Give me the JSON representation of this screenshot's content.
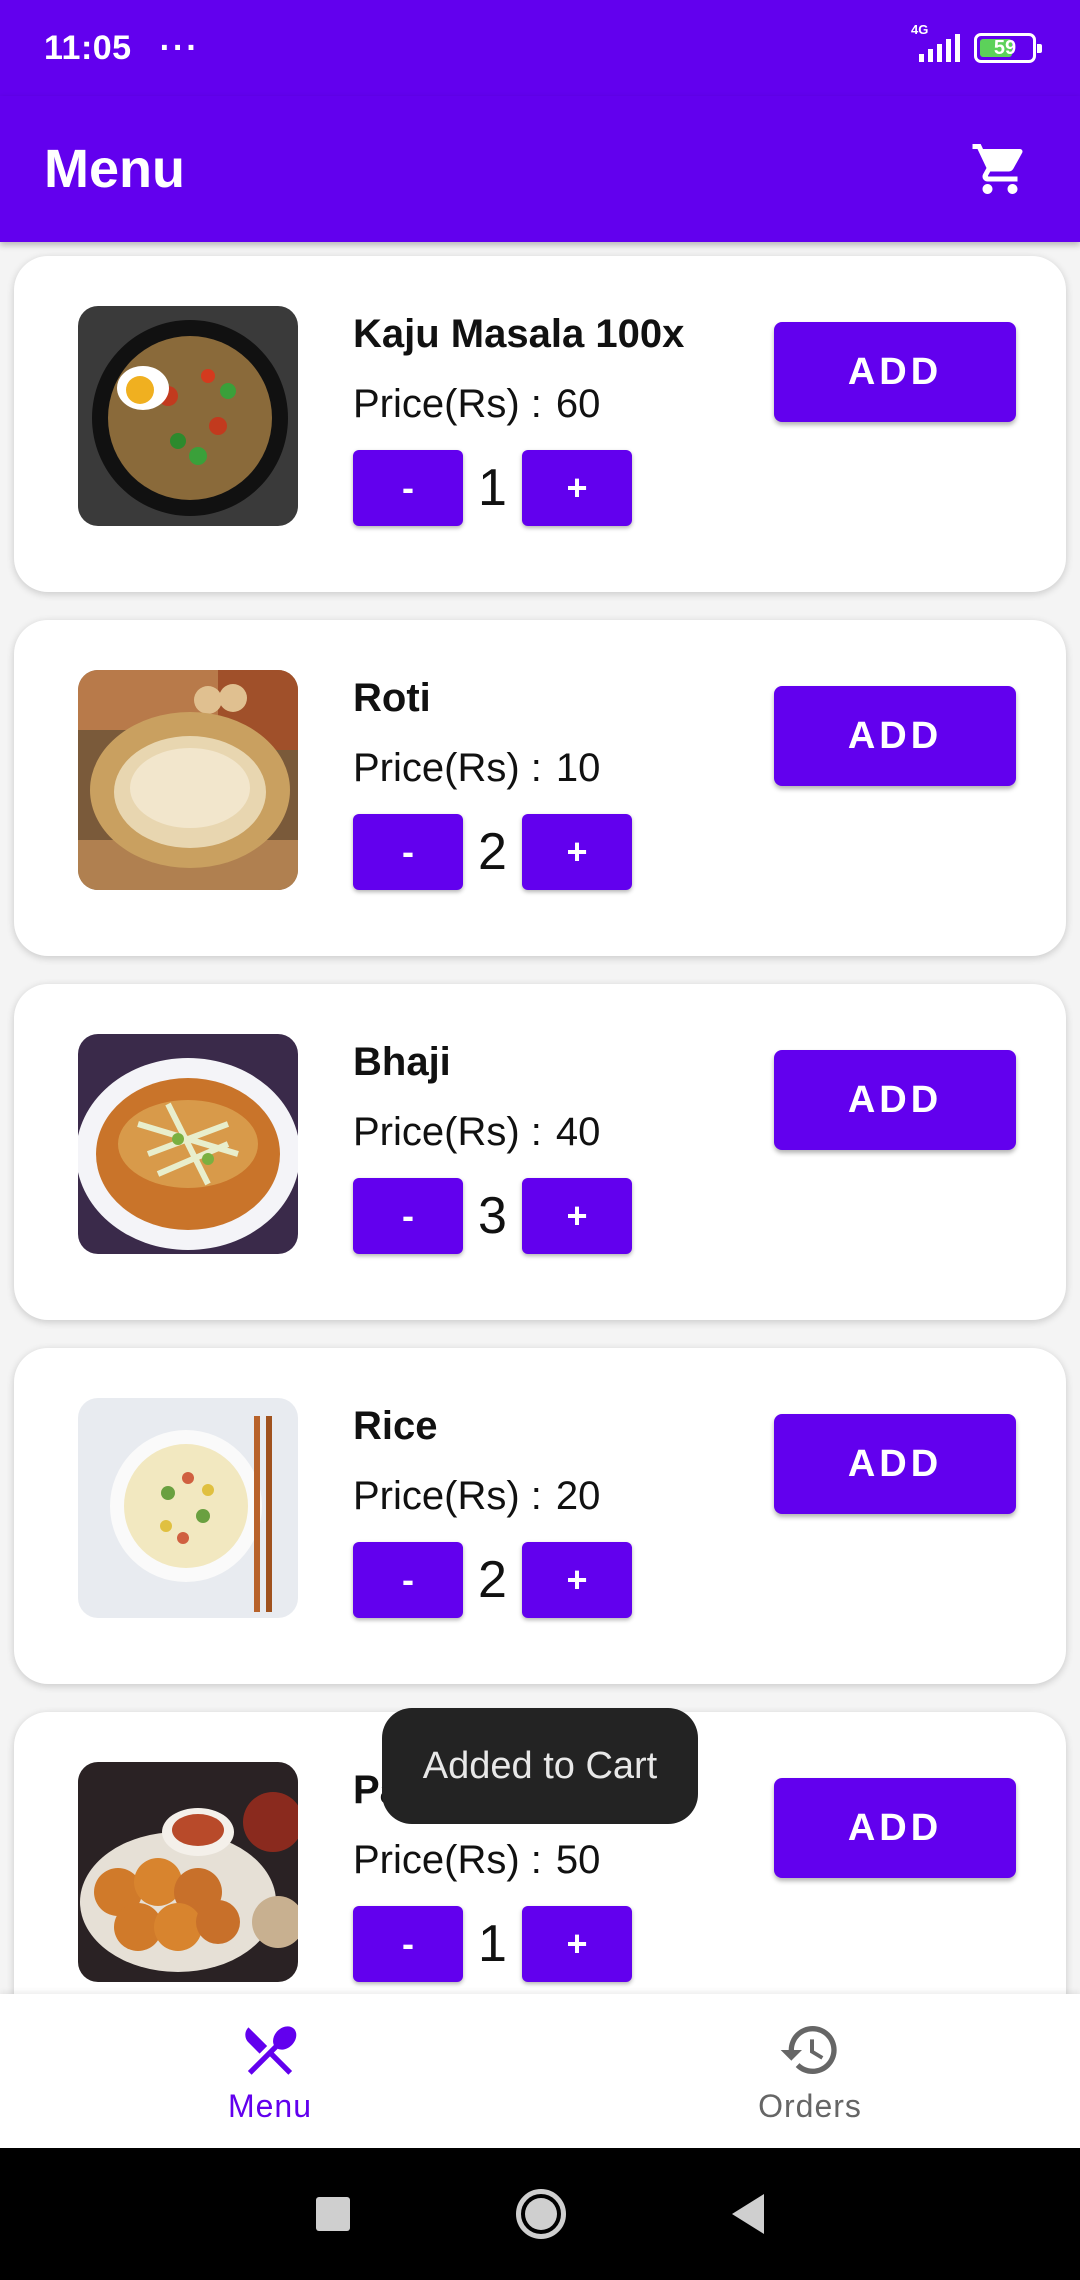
{
  "status_bar": {
    "time": "11:05",
    "more": "···",
    "network": "4G",
    "battery": "59"
  },
  "app_bar": {
    "title": "Menu",
    "cart_icon": "cart-icon"
  },
  "items": [
    {
      "name": "Kaju Masala 100x",
      "price_label": "Price(Rs) :",
      "price": "60",
      "qty": "1",
      "minus": "-",
      "plus": "+",
      "add": "ADD"
    },
    {
      "name": "Roti",
      "price_label": "Price(Rs) :",
      "price": "10",
      "qty": "2",
      "minus": "-",
      "plus": "+",
      "add": "ADD"
    },
    {
      "name": "Bhaji",
      "price_label": "Price(Rs) :",
      "price": "40",
      "qty": "3",
      "minus": "-",
      "plus": "+",
      "add": "ADD"
    },
    {
      "name": "Rice",
      "price_label": "Price(Rs) :",
      "price": "20",
      "qty": "2",
      "minus": "-",
      "plus": "+",
      "add": "ADD"
    },
    {
      "name": "Pa",
      "price_label": "Price(Rs) :",
      "price": "50",
      "qty": "1",
      "minus": "-",
      "plus": "+",
      "add": "ADD"
    }
  ],
  "toast": {
    "text": "Added to Cart"
  },
  "bottom_nav": [
    {
      "label": "Menu",
      "icon": "fork-knife-icon",
      "active": true
    },
    {
      "label": "Orders",
      "icon": "history-icon",
      "active": false
    }
  ],
  "colors": {
    "primary": "#6200ee",
    "toast_bg": "#232323"
  }
}
